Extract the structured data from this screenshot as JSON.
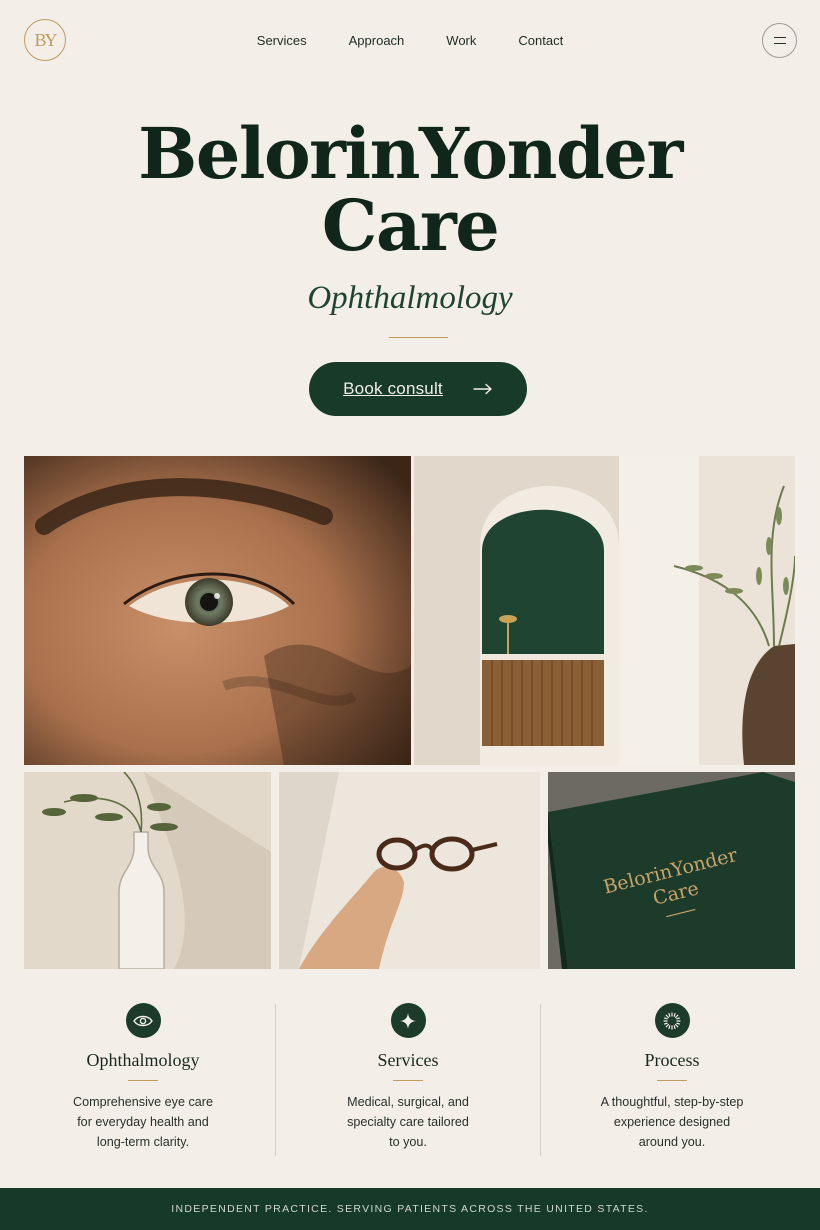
{
  "header": {
    "logo_text": "BY",
    "nav": [
      "Services",
      "Approach",
      "Work",
      "Contact"
    ],
    "menu_icon": "menu-icon"
  },
  "hero": {
    "title_line1": "BelorinYonder",
    "title_line2": "Care",
    "subtitle": "Ophthalmology",
    "cta_label": "Book consult",
    "cta_icon": "arrow-right-icon"
  },
  "gallery": {
    "book_title_line1": "BelorinYonder",
    "book_title_line2": "Care"
  },
  "features": [
    {
      "icon": "eye-icon",
      "title": "Ophthalmology",
      "lines": [
        "Comprehensive eye care",
        "for everyday health and",
        "long-term clarity."
      ]
    },
    {
      "icon": "sparkle-icon",
      "title": "Services",
      "lines": [
        "Medical, surgical, and",
        "specialty care tailored",
        "to you."
      ]
    },
    {
      "icon": "sunburst-icon",
      "title": "Process",
      "lines": [
        "A thoughtful, step-by-step",
        "experience designed",
        "around you."
      ]
    }
  ],
  "footer": {
    "text": "INDEPENDENT PRACTICE. SERVING PATIENTS ACROSS THE UNITED STATES."
  },
  "colors": {
    "background": "#f3efe8",
    "primary_green": "#183a29",
    "gold_accent": "#c29b5c"
  }
}
